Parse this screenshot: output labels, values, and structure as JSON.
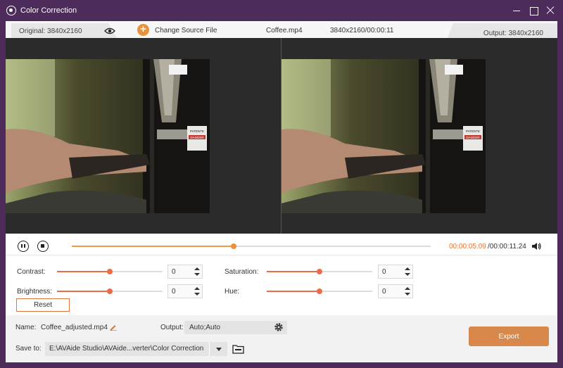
{
  "window": {
    "title": "Color Correction"
  },
  "infobar": {
    "original_label": "Original: 3840x2160",
    "change_source_label": "Change Source File",
    "file_name": "Coffee.mp4",
    "file_info": "3840x2160/00:00:11",
    "output_label": "Output: 3840x2160"
  },
  "preview": {
    "sign_line1": "PATENTE",
    "sign_line2": "DANGER"
  },
  "playback": {
    "current_time": "00:00:05.09",
    "total_time": "/00:00:11.24",
    "progress": 0.45
  },
  "adjustments": {
    "contrast": {
      "label": "Contrast:",
      "value": "0",
      "level": 0.5
    },
    "brightness": {
      "label": "Brightness:",
      "value": "0",
      "level": 0.5
    },
    "saturation": {
      "label": "Saturation:",
      "value": "0",
      "level": 0.5
    },
    "hue": {
      "label": "Hue:",
      "value": "0",
      "level": 0.5
    },
    "reset_label": "Reset"
  },
  "output_panel": {
    "name_label": "Name:",
    "name_value": "Coffee_adjusted.mp4",
    "output_label": "Output:",
    "output_value": "Auto;Auto",
    "save_label": "Save to:",
    "save_path": "E:\\AVAide Studio\\AVAide...verter\\Color Correction",
    "export_label": "Export"
  },
  "colors": {
    "title_bar": "#4d2b5a",
    "accent_orange": "#e2763a",
    "slider_accent": "#ec6c4a",
    "export_button": "#d9884b"
  },
  "icons": [
    "app-logo-icon",
    "minimize-icon",
    "maximize-icon",
    "close-icon",
    "eye-icon",
    "plus-icon",
    "pause-icon",
    "stop-icon",
    "volume-icon",
    "edit-icon",
    "gear-icon",
    "folder-icon",
    "chevron-down-icon"
  ]
}
